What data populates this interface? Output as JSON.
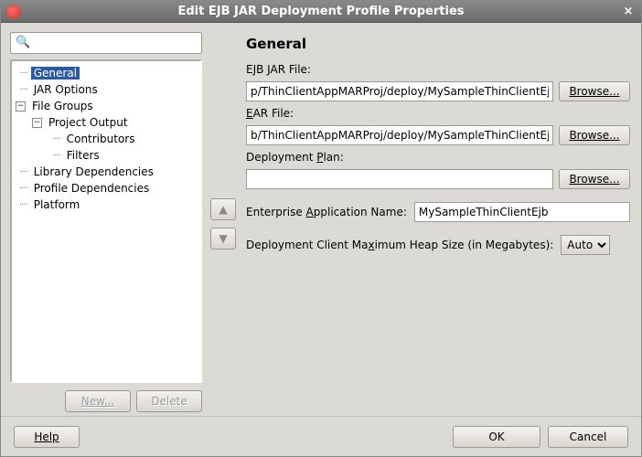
{
  "window": {
    "title": "Edit EJB JAR Deployment Profile Properties",
    "close": "×"
  },
  "search": {
    "placeholder": ""
  },
  "tree": {
    "general": "General",
    "jar_options": "JAR Options",
    "file_groups": "File Groups",
    "project_output": "Project Output",
    "contributors": "Contributors",
    "filters": "Filters",
    "library_deps": "Library Dependencies",
    "profile_deps": "Profile Dependencies",
    "platform": "Platform"
  },
  "tree_buttons": {
    "new": "New...",
    "delete": "Delete"
  },
  "panel": {
    "title": "General",
    "ejb_jar_label_pre": "EJB ",
    "ejb_jar_label_und": "J",
    "ejb_jar_label_post": "AR File:",
    "ejb_jar_value": "p/ThinClientAppMARProj/deploy/MySampleThinClientEjb.jar",
    "ear_label_pre": "",
    "ear_label_und": "E",
    "ear_label_post": "AR File:",
    "ear_value": "b/ThinClientAppMARProj/deploy/MySampleThinClientEjb.ear",
    "plan_label_pre": "Deployment ",
    "plan_label_und": "P",
    "plan_label_post": "lan:",
    "plan_value": "",
    "browse": "Browse...",
    "ent_app_label_pre": "Enterprise ",
    "ent_app_label_und": "A",
    "ent_app_label_post": "pplication Name:",
    "ent_app_value": "MySampleThinClientEjb",
    "heap_label_pre": "Deployment Client Ma",
    "heap_label_und": "x",
    "heap_label_post": "imum Heap Size (in Megabytes):",
    "heap_value": "Auto"
  },
  "buttons": {
    "help": "Help",
    "ok": "OK",
    "cancel": "Cancel"
  },
  "glyph": {
    "minus": "−",
    "up": "▲",
    "down": "▼"
  }
}
